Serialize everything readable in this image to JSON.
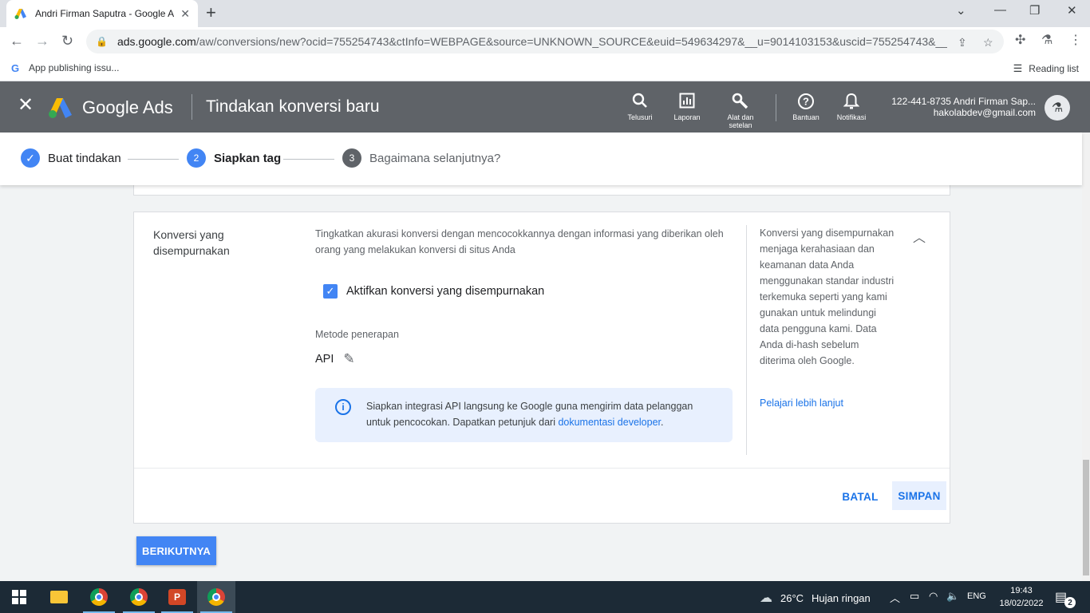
{
  "browser": {
    "tab_title": "Andri Firman Saputra - Google Ads",
    "tab_close": "✕",
    "new_tab": "+",
    "window_controls": {
      "minimize": "—",
      "restore": "❐",
      "close": "✕",
      "tab_search": "⌄"
    },
    "url_host": "ads.google.com",
    "url_path": "/aw/conversions/new?ocid=755254743&ctInfo=WEBPAGE&source=UNKNOWN_SOURCE&euid=549634297&__u=9014103153&uscid=755254743&__c...",
    "bookmark_label": "App publishing issu...",
    "reading_list_label": "Reading list"
  },
  "ads_header": {
    "close_label": "✕",
    "product_name": "Google Ads",
    "page_title": "Tindakan konversi baru",
    "tools": [
      {
        "icon": "search-icon",
        "label": "Telusuri"
      },
      {
        "icon": "reports-icon",
        "label": "Laporan"
      },
      {
        "icon": "wrench-icon",
        "label": "Alat dan setelan"
      },
      {
        "icon": "help-icon",
        "label": "Bantuan"
      },
      {
        "icon": "bell-icon",
        "label": "Notifikasi"
      }
    ],
    "account_line": "122-441-8735 Andri Firman Sap...",
    "account_email": "hakolabdev@gmail.com"
  },
  "stepper": {
    "steps": [
      {
        "number": "✓",
        "label": "Buat tindakan",
        "state": "done"
      },
      {
        "number": "2",
        "label": "Siapkan tag",
        "state": "active"
      },
      {
        "number": "3",
        "label": "Bagaimana selanjutnya?",
        "state": "pending"
      }
    ]
  },
  "card": {
    "label": "Konversi yang disempurnakan",
    "description": "Tingkatkan akurasi konversi dengan mencocokkannya dengan informasi yang diberikan oleh orang yang melakukan konversi di situs Anda",
    "checkbox_label": "Aktifkan konversi yang disempurnakan",
    "checkbox_checked": true,
    "method_label": "Metode penerapan",
    "method_value": "API",
    "info_text": "Siapkan integrasi API langsung ke Google guna mengirim data pelanggan untuk pencocokan. Dapatkan petunjuk dari ",
    "info_link": "dokumentasi developer",
    "info_end": ".",
    "side_text": "Konversi yang disempurnakan menjaga kerahasiaan dan keamanan data Anda menggunakan standar industri terkemuka seperti yang kami gunakan untuk melindungi data pengguna kami. Data Anda di-hash sebelum diterima oleh Google.",
    "side_link": "Pelajari lebih lanjut",
    "cancel_label": "BATAL",
    "save_label": "SIMPAN"
  },
  "next_label": "BERIKUTNYA",
  "taskbar": {
    "weather_temp": "26°C",
    "weather_desc": "Hujan ringan",
    "language": "ENG",
    "time": "19:43",
    "date": "18/02/2022",
    "notification_count": "2"
  },
  "colors": {
    "accent": "#1a73e8",
    "header_bg": "#5f6368",
    "step_active": "#4285f4",
    "step_pending": "#5f6368",
    "taskbar": "#1c2a36"
  }
}
